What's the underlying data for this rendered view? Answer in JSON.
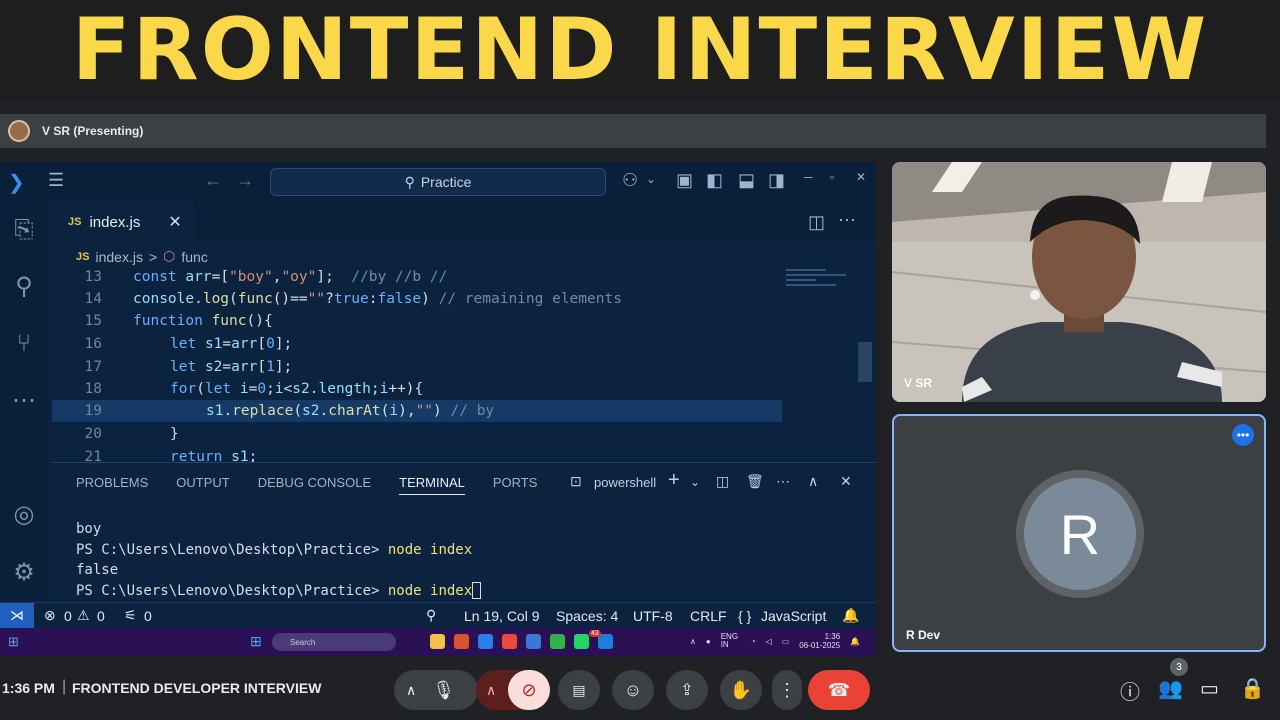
{
  "banner": {
    "title": "FRONTEND INTERVIEW"
  },
  "meet": {
    "presenter_label": "V SR (Presenting)",
    "time": "1:36 PM",
    "separator": "|",
    "meeting_title": "FRONTEND DEVELOPER INTERVIEW",
    "participant_count": "3",
    "tiles": [
      {
        "name": "V SR"
      },
      {
        "name": "R Dev",
        "initial": "R"
      }
    ]
  },
  "vscode": {
    "search_text": "Practice",
    "tab_label": "index.js",
    "tab_badge": "JS",
    "breadcrumb": {
      "file": "index.js",
      "separator": ">",
      "symbol": "func"
    },
    "lines": [
      {
        "num": "13"
      },
      {
        "num": "14"
      },
      {
        "num": "15"
      },
      {
        "num": "16"
      },
      {
        "num": "17"
      },
      {
        "num": "18"
      },
      {
        "num": "19"
      },
      {
        "num": "20"
      },
      {
        "num": "21"
      }
    ],
    "panel_tabs": [
      "PROBLEMS",
      "OUTPUT",
      "DEBUG CONSOLE",
      "TERMINAL",
      "PORTS"
    ],
    "shell_label": "powershell",
    "terminal": {
      "out1": "boy",
      "prompt": "PS C:\\Users\\Lenovo\\Desktop\\Practice>",
      "cmd": "node index",
      "out2": "false"
    },
    "status": {
      "errors": "0",
      "warnings": "0",
      "ports": "0",
      "position": "Ln 19, Col 9",
      "spaces": "Spaces: 4",
      "encoding": "UTF-8",
      "eol": "CRLF",
      "language": "JavaScript",
      "lang_icon": "{ }"
    }
  },
  "windows": {
    "search_label": "Search",
    "tray_lang": "ENG IN",
    "tray_time": "1:36",
    "tray_date": "06-01-2025",
    "mail_badge": "43"
  }
}
